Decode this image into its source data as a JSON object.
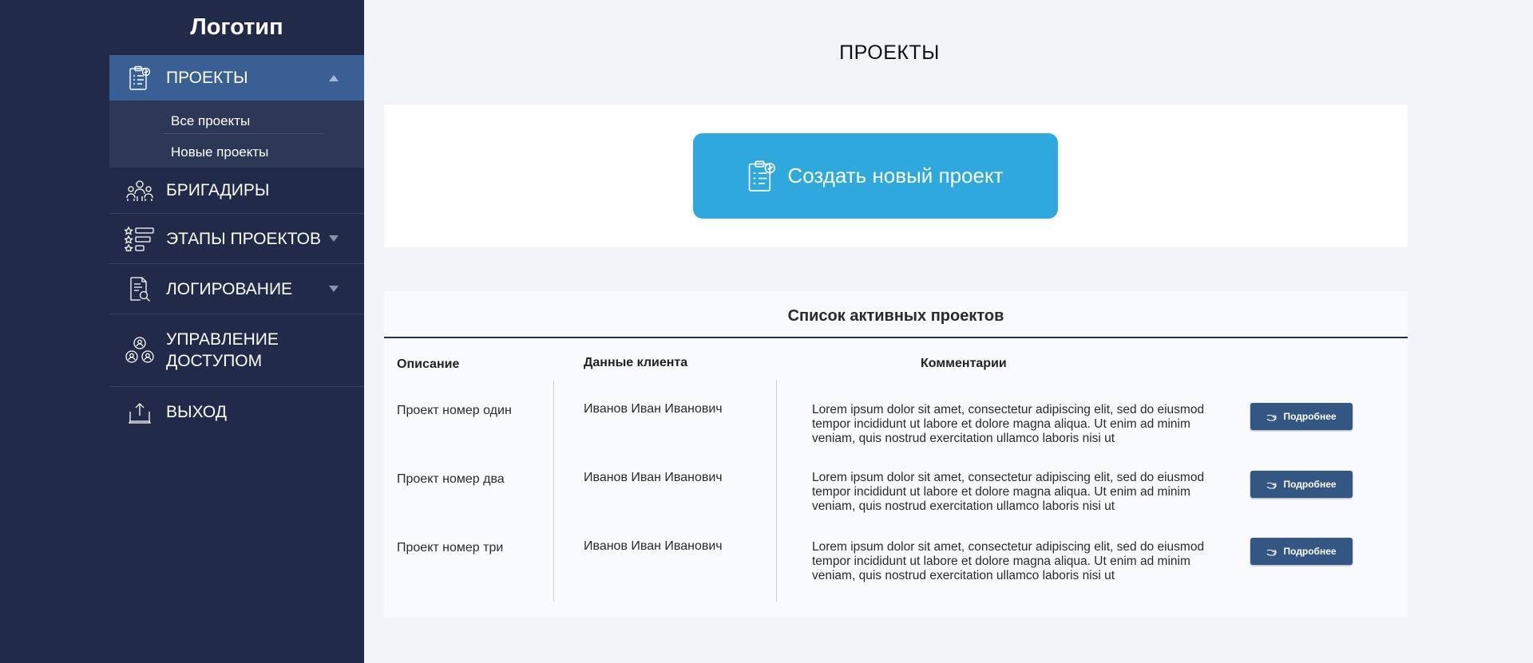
{
  "sidebar": {
    "logo": "Логотип",
    "menu": [
      {
        "label": "ПРОЕКТЫ",
        "icon": "clipboard-check-icon",
        "expanded": true,
        "submenu": [
          "Все проекты",
          "Новые проекты"
        ]
      },
      {
        "label": "БРИГАДИРЫ",
        "icon": "team-icon"
      },
      {
        "label": "ЭТАПЫ ПРОЕКТОВ",
        "icon": "stages-list-icon"
      },
      {
        "label": "ЛОГИРОВАНИЕ",
        "icon": "document-search-icon"
      },
      {
        "label_line1": "УПРАВЛЕНИЕ",
        "label_line2": "ДОСТУПОМ",
        "icon": "users-access-icon"
      },
      {
        "label": "ВЫХОД",
        "icon": "logout-icon"
      }
    ]
  },
  "main": {
    "title": "ПРОЕКТЫ",
    "create_button": "Создать новый проект",
    "list": {
      "title": "Список активных проектов",
      "columns": {
        "description": "Описание",
        "client": "Данные клиента",
        "comments": "Комментарии"
      },
      "rows": [
        {
          "description": "Проект номер один",
          "client": "Иванов Иван Иванович",
          "comment": "Lorem ipsum dolor sit amet, consectetur adipiscing elit, sed do eiusmod tempor incididunt ut labore et dolore magna aliqua. Ut enim ad minim veniam, quis nostrud exercitation ullamco laboris nisi ut",
          "button": "Подробнее"
        },
        {
          "description": "Проект номер два",
          "client": "Иванов Иван Иванович",
          "comment": "Lorem ipsum dolor sit amet, consectetur adipiscing elit, sed do eiusmod tempor incididunt ut labore et dolore magna aliqua. Ut enim ad minim veniam, quis nostrud exercitation ullamco laboris nisi ut",
          "button": "Подробнее"
        },
        {
          "description": "Проект номер три",
          "client": "Иванов Иван Иванович",
          "comment": "Lorem ipsum dolor sit amet, consectetur adipiscing elit, sed do eiusmod tempor incididunt ut labore et dolore magna aliqua. Ut enim ad minim veniam, quis nostrud exercitation ullamco laboris nisi ut",
          "button": "Подробнее"
        }
      ]
    }
  },
  "colors": {
    "sidebar": "#212b49",
    "active": "#3a5f94",
    "accent": "#2ea8dd",
    "button": "#345682"
  }
}
